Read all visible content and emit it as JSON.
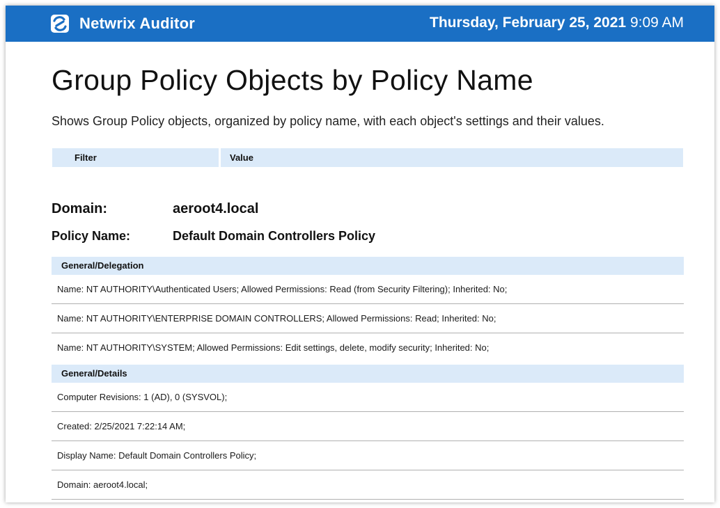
{
  "header": {
    "app_name": "Netwrix Auditor",
    "date": "Thursday, February 25, 2021",
    "time": "9:09 AM",
    "logo_icon": "netwrix-logo-icon",
    "bar_color": "#1a6fc4"
  },
  "report": {
    "title": "Group Policy Objects by Policy Name",
    "description": "Shows Group Policy objects, organized by policy name, with each object's settings and their values."
  },
  "filter_table": {
    "headers": [
      "Filter",
      "Value"
    ]
  },
  "group": {
    "domain_label": "Domain:",
    "domain_value": "aeroot4.local",
    "policy_label": "Policy Name:",
    "policy_value": "Default Domain Controllers Policy"
  },
  "sections": [
    {
      "title": "General/Delegation",
      "rows": [
        "Name: NT AUTHORITY\\Authenticated Users; Allowed Permissions: Read (from Security Filtering); Inherited: No;",
        "Name: NT AUTHORITY\\ENTERPRISE DOMAIN CONTROLLERS; Allowed Permissions: Read; Inherited: No;",
        "Name: NT AUTHORITY\\SYSTEM; Allowed Permissions: Edit settings, delete, modify security; Inherited: No;"
      ]
    },
    {
      "title": "General/Details",
      "rows": [
        "Computer Revisions: 1 (AD), 0 (SYSVOL);",
        "Created: 2/25/2021 7:22:14 AM;",
        "Display Name: Default Domain Controllers Policy;",
        "Domain: aeroot4.local;"
      ]
    }
  ]
}
